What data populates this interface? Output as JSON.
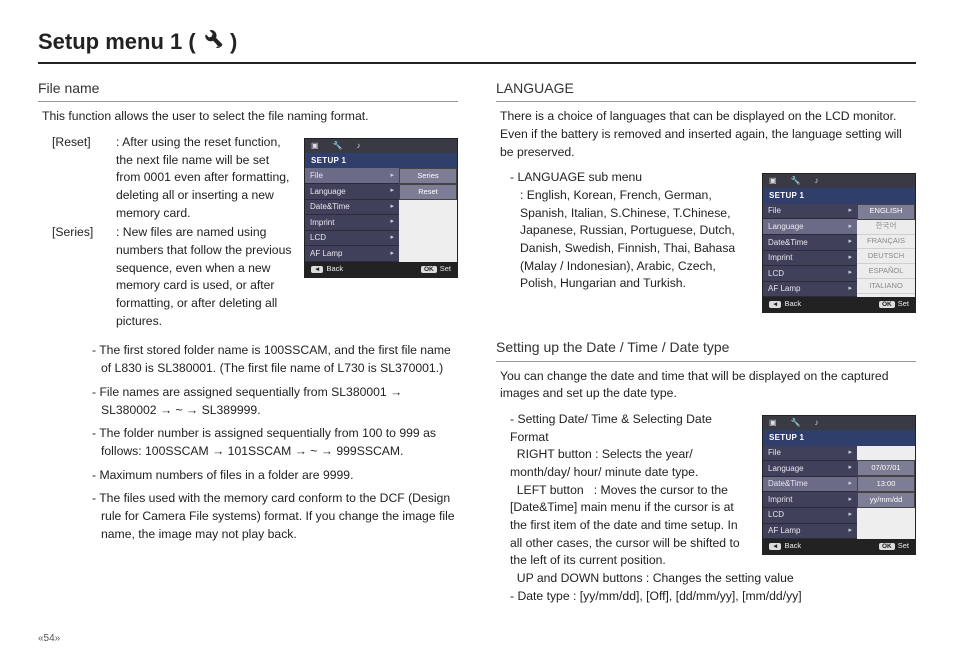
{
  "title": "Setup menu 1 (",
  "title_close": ")",
  "page_number": "«54»",
  "left": {
    "h": "File name",
    "intro": "This function allows the user to select the file naming format.",
    "defs": [
      {
        "term": "[Reset]",
        "text": ": After using the reset function, the next file name will be set from 0001 even after formatting, deleting all or inserting a new memory card."
      },
      {
        "term": "[Series]",
        "text": ": New files are named using numbers that follow the previous sequence, even when a new memory card is used, or after formatting, or after deleting all pictures."
      }
    ],
    "bullets": [
      "The first stored folder name is 100SSCAM, and the first file name of L830 is SL380001. (The first file name of L730 is SL370001.)",
      "File names are assigned sequentially from SL380001 → SL380002 → ~ → SL389999.",
      "The folder number is assigned sequentially from 100 to 999 as follows: 100SSCAM → 101SSCAM → ~ → 999SSCAM.",
      "Maximum numbers of files in a folder are 9999.",
      "The files used with the memory card conform to the DCF (Design rule for Camera File systems) format. If you change the image file name, the image may not play back."
    ],
    "screen": {
      "hd": "SETUP 1",
      "menu": [
        "File",
        "Language",
        "Date&Time",
        "Imprint",
        "LCD",
        "AF Lamp"
      ],
      "vals": [
        "Series",
        "Reset"
      ],
      "back": "Back",
      "set": "Set"
    }
  },
  "right": {
    "lang_h": "LANGUAGE",
    "lang_intro": "There is a choice of languages that can be displayed on the LCD monitor. Even if the battery is removed and inserted again, the language setting will be preserved.",
    "lang_sub_label": "- LANGUAGE sub menu",
    "lang_sub_text": ": English, Korean, French, German, Spanish, Italian, S.Chinese, T.Chinese, Japanese, Russian, Portuguese, Dutch, Danish, Swedish, Finnish, Thai, Bahasa (Malay / Indonesian), Arabic, Czech, Polish, Hungarian and Turkish.",
    "lang_screen": {
      "hd": "SETUP 1",
      "menu": [
        "File",
        "Language",
        "Date&Time",
        "Imprint",
        "LCD",
        "AF Lamp"
      ],
      "vals": [
        "ENGLISH",
        "한국어",
        "FRANÇAIS",
        "DEUTSCH",
        "ESPAÑOL",
        "ITALIANO"
      ],
      "back": "Back",
      "set": "Set"
    },
    "date_h": "Setting up the Date / Time / Date type",
    "date_intro": "You can change the date and time that will be displayed on the captured images and set up the date type.",
    "date_lines": [
      "- Setting Date/ Time & Selecting Date Format",
      "  RIGHT button : Selects the year/ month/day/ hour/ minute date type.",
      "  LEFT button   : Moves the cursor to the [Date&Time] main menu if the cursor is at the first item of the date and time setup. In all other cases, the cursor will be shifted to the left of its current position.",
      "  UP and DOWN buttons : Changes the setting value",
      "- Date type : [yy/mm/dd], [Off], [dd/mm/yy], [mm/dd/yy]"
    ],
    "date_screen": {
      "hd": "SETUP 1",
      "menu": [
        "File",
        "Language",
        "Date&Time",
        "Imprint",
        "LCD",
        "AF Lamp"
      ],
      "vals": [
        "",
        "07/07/01",
        "13:00",
        "yy/mm/dd",
        "",
        ""
      ],
      "back": "Back",
      "set": "Set"
    }
  }
}
